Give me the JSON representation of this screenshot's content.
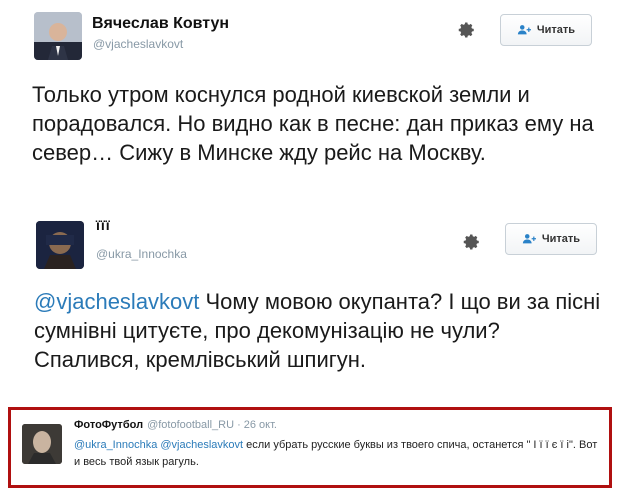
{
  "tweets": [
    {
      "author": {
        "name": "Вячеслав Ковтун",
        "handle": "@vjacheslavkovt"
      },
      "follow_label": "Читать",
      "text": "Только утром коснулся родной киевской земли и порадовался. Но видно как в песне: дан приказ ему на север… Сижу в Минске жду рейс на Москву."
    },
    {
      "author": {
        "name": "ïïï",
        "handle": "@ukra_Innochka"
      },
      "follow_label": "Читать",
      "mention": "@vjacheslavkovt",
      "text": " Чому мовою окупанта? І що ви за пісні сумнівні цитуєте, про декомунізацію не чули? Спалився, кремлівський шпигун."
    }
  ],
  "reply": {
    "author": {
      "name": "ФотоФутбол",
      "handle": "@fotofootball_RU"
    },
    "separator": "·",
    "time": "26 окт.",
    "mentions": [
      "@ukra_Innochka",
      "@vjacheslavkovt"
    ],
    "text": " если убрать русские буквы из твоего спича, останется \" І ї ї є ї і\". Вот и весь твой язык рагуль."
  },
  "colors": {
    "mention": "#2b7bb9",
    "handle": "#8899a6",
    "highlight_border": "#b01010"
  },
  "icons": {
    "settings": "gear-icon",
    "follow": "person-add-icon"
  }
}
